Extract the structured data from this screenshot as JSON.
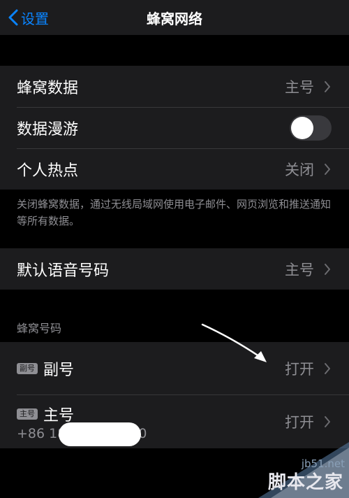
{
  "nav": {
    "back_label": "设置",
    "title": "蜂窝网络"
  },
  "group1": {
    "cellular_data": {
      "label": "蜂窝数据",
      "value": "主号"
    },
    "roaming": {
      "label": "数据漫游",
      "enabled": false
    },
    "hotspot": {
      "label": "个人热点",
      "value": "关闭"
    }
  },
  "group1_footer": "关闭蜂窝数据，通过无线局域网使用电子邮件、网页浏览和推送通知等所有数据。",
  "group2": {
    "default_voice": {
      "label": "默认语音号码",
      "value": "主号"
    }
  },
  "section_cellular_numbers": "蜂窝号码",
  "sims": [
    {
      "badge": "副号",
      "label": "副号",
      "value": "打开"
    },
    {
      "badge": "主号",
      "label": "主号",
      "phone_prefix": "+86 18",
      "phone_suffix": "0",
      "value": "打开"
    }
  ],
  "watermark": {
    "url": "jb51.net",
    "text": "脚本之家"
  },
  "colors": {
    "accent": "#0a84ff",
    "cell_bg": "#1c1c1e",
    "secondary_text": "#8e8e93"
  }
}
